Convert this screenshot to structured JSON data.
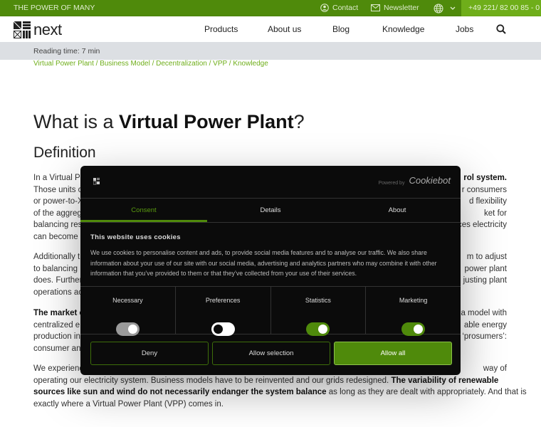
{
  "topbar": {
    "slogan": "THE POWER OF MANY",
    "contact": "Contact",
    "newsletter": "Newsletter",
    "language_icon": "globe-icon",
    "phone": "+49 221/ 82 00 85 - 0"
  },
  "nav": {
    "logo": "next",
    "items": [
      "Products",
      "About us",
      "Blog",
      "Knowledge",
      "Jobs"
    ]
  },
  "reading_time": "Reading time: 7 min",
  "breadcrumb": "Virtual Power Plant / Business Model / Decentralization / VPP / Knowledge",
  "article": {
    "title_pre": "What is a ",
    "title_bold": "Virtual Power Plant",
    "title_post": "?",
    "subtitle": "Definition",
    "lines": [
      {
        "l": "In a Virtual Po",
        "r": "rol system.",
        "rb": true
      },
      {
        "l": "Those units c",
        "r": "r consumers"
      },
      {
        "l": "or power-to-X",
        "r": "d flexibility"
      },
      {
        "l": "of the aggreg",
        "r": "ket for"
      },
      {
        "l": "balancing res",
        "r": "ces electricity"
      },
      {
        "l": "can become a",
        "r": ""
      },
      {
        "l": "Additionally t",
        "r": "m to adjust"
      },
      {
        "l": "to balancing",
        "r": "power plant"
      },
      {
        "l": "does. Further",
        "r": "justing plant"
      },
      {
        "l": "operations ac",
        "r": ""
      },
      {
        "l": "The market c",
        "lb": true,
        "r": "a model with"
      },
      {
        "l": "centralized el",
        "r": "able energy"
      },
      {
        "l": "production in",
        "r": "‘prosumers’:"
      },
      {
        "l": "consumer and",
        "r": ""
      },
      {
        "l": "We experienc",
        "r": "way of"
      }
    ],
    "last_para": {
      "a": "operating our electricity system. Business models have to be reinvented and our grids redesigned. ",
      "b": "The variability of renewable",
      "c": "sources like sun and wind do not necessarily endanger the system balance",
      "d": " as long as they are dealt with appropriately. And that is",
      "e": "exactly where a Virtual Power Plant (VPP) comes in."
    }
  },
  "cookie": {
    "powered_by": "Powered by",
    "brand": "Cookiebot",
    "tabs": [
      "Consent",
      "Details",
      "About"
    ],
    "title": "This website uses cookies",
    "text": "We use cookies to personalise content and ads, to provide social media features and to analyse our traffic. We also share information about your use of our site with our social media, advertising and analytics partners who may combine it with other information that you’ve provided to them or that they’ve collected from your use of their services.",
    "toggles": [
      {
        "label": "Necessary",
        "on": true,
        "disabled": true
      },
      {
        "label": "Preferences",
        "on": false
      },
      {
        "label": "Statistics",
        "on": true
      },
      {
        "label": "Marketing",
        "on": true
      }
    ],
    "buttons": [
      "Deny",
      "Allow selection",
      "Allow all"
    ],
    "accent": "#4f8a0b"
  }
}
